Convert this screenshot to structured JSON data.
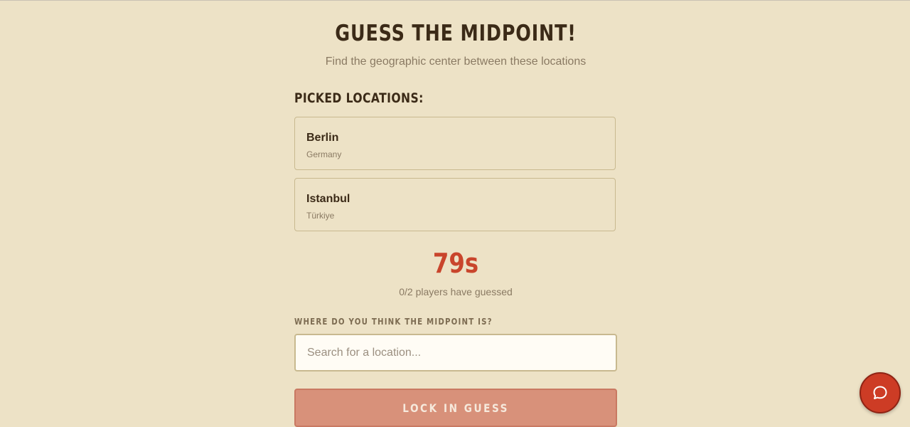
{
  "header": {
    "title": "GUESS THE MIDPOINT!",
    "subtitle": "Find the geographic center between these locations"
  },
  "picked_locations": {
    "heading": "PICKED LOCATIONS:",
    "items": [
      {
        "name": "Berlin",
        "country": "Germany"
      },
      {
        "name": "Istanbul",
        "country": "Türkiye"
      }
    ]
  },
  "status": {
    "timer": "79s",
    "players_guessed": "0/2 players have guessed"
  },
  "guess_form": {
    "label": "WHERE DO YOU THINK THE MIDPOINT IS?",
    "placeholder": "Search for a location...",
    "value": "",
    "submit_label": "LOCK IN GUESS"
  },
  "chat": {
    "icon": "chat-bubble-icon"
  },
  "colors": {
    "background": "#ede2c6",
    "accent": "#c9452c",
    "button": "#d8917a"
  }
}
